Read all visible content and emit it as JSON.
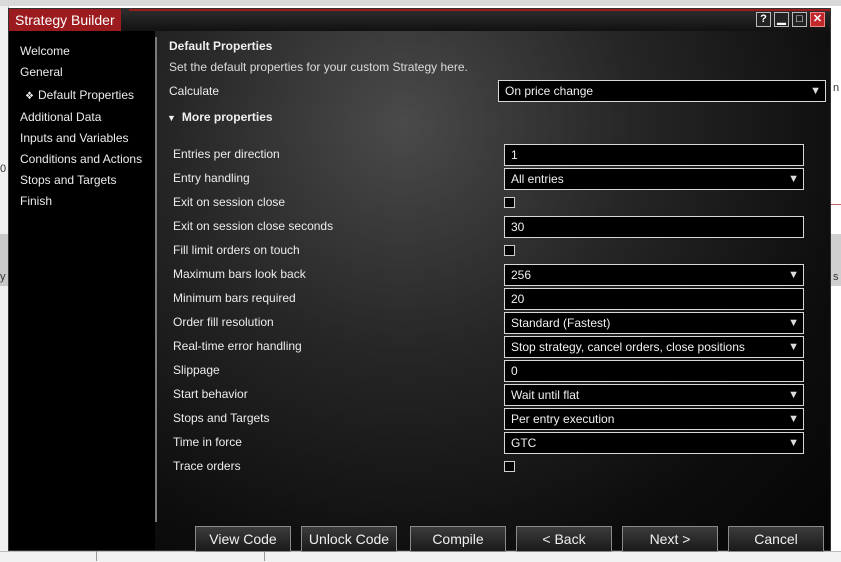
{
  "window": {
    "title": "Strategy Builder",
    "controls": {
      "help": "?",
      "minimize": "▁",
      "maximize": "□",
      "close": "✕"
    }
  },
  "nav": {
    "items": [
      {
        "label": "Welcome",
        "sub": false
      },
      {
        "label": "General",
        "sub": false
      },
      {
        "label": "Default Properties",
        "sub": true,
        "bullet": "❖"
      },
      {
        "label": "Additional Data",
        "sub": false
      },
      {
        "label": "Inputs and Variables",
        "sub": false
      },
      {
        "label": "Conditions and Actions",
        "sub": false
      },
      {
        "label": "Stops and Targets",
        "sub": false
      },
      {
        "label": "Finish",
        "sub": false
      }
    ]
  },
  "main": {
    "title": "Default Properties",
    "description": "Set the default properties for your custom Strategy here.",
    "calculate": {
      "label": "Calculate",
      "value": "On price change"
    },
    "more_properties_label": "More properties",
    "properties": [
      {
        "label": "Entries per direction",
        "type": "text",
        "value": "1"
      },
      {
        "label": "Entry handling",
        "type": "select",
        "value": "All entries"
      },
      {
        "label": "Exit on session close",
        "type": "checkbox",
        "checked": false
      },
      {
        "label": "Exit on session close seconds",
        "type": "text",
        "value": "30"
      },
      {
        "label": "Fill limit orders on touch",
        "type": "checkbox",
        "checked": false
      },
      {
        "label": "Maximum bars look back",
        "type": "select",
        "value": "256"
      },
      {
        "label": "Minimum bars required",
        "type": "text",
        "value": "20"
      },
      {
        "label": "Order fill resolution",
        "type": "select",
        "value": "Standard (Fastest)"
      },
      {
        "label": "Real-time error handling",
        "type": "select",
        "value": "Stop strategy, cancel orders, close positions"
      },
      {
        "label": "Slippage",
        "type": "text",
        "value": "0"
      },
      {
        "label": "Start behavior",
        "type": "select",
        "value": "Wait until flat"
      },
      {
        "label": "Stops and Targets",
        "type": "select",
        "value": "Per entry execution"
      },
      {
        "label": "Time in force",
        "type": "select",
        "value": "GTC"
      },
      {
        "label": "Trace orders",
        "type": "checkbox",
        "checked": false
      }
    ]
  },
  "buttons": {
    "view_code": "View Code",
    "unlock_code": "Unlock Code",
    "compile": "Compile",
    "back": "< Back",
    "next": "Next >",
    "cancel": "Cancel"
  },
  "background_fragments": {
    "right_n": "n",
    "right_s": "s",
    "left_y": "y",
    "left_o": "0"
  },
  "colors": {
    "title_accent": "#9c1b1f",
    "panel_bg": "#000000",
    "field_border": "#d8d8d8"
  },
  "icons": {
    "dropdown": "chevron-down-icon",
    "expand": "triangle-down-icon",
    "nav_bullet": "diamond-icon"
  }
}
